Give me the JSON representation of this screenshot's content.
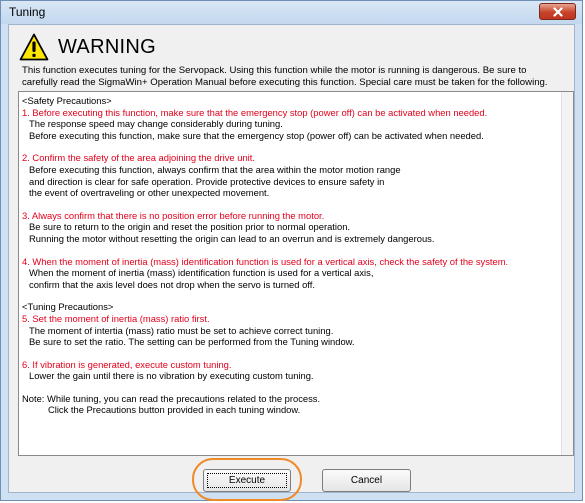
{
  "window": {
    "title": "Tuning",
    "close_icon": "close-icon",
    "accent_close": "#c7432b",
    "titlebar_color": "#cfe0f3"
  },
  "warning": {
    "icon": "warning-icon",
    "heading": "WARNING",
    "intro_line1": "This function executes tuning for the Servopack. Using this function while the motor is running is dangerous. Be sure to",
    "intro_line2": "carefully read the SigmaWin+ Operation Manual before executing this function. Special care must be taken for the following."
  },
  "precautions": {
    "safety_header": "<Safety Precautions>",
    "items": [
      {
        "title": "1. Before executing this function, make sure that the emergency stop (power off) can be activated when needed.",
        "lines": [
          "The response speed may change considerably during tuning.",
          "Before executing this function, make sure that the emergency stop (power off) can be activated when needed."
        ]
      },
      {
        "title": "2. Confirm the safety of the area adjoining the drive unit.",
        "lines": [
          "Before executing this function, always confirm that the area within the motor motion range",
          "and direction is clear for safe operation. Provide protective devices to ensure safety in",
          "the event of overtraveling or other unexpected movement."
        ]
      },
      {
        "title": "3. Always confirm that there is no position error before running the motor.",
        "lines": [
          "Be sure to return to the origin and reset the position prior to normal operation.",
          "Running the motor without resetting the origin can lead to an overrun and is extremely dangerous."
        ]
      },
      {
        "title": "4. When the moment of inertia (mass) identification function is used for a vertical axis, check the safety of the system.",
        "lines": [
          "When the moment of inertia (mass) identification function is used for a vertical axis,",
          "confirm that the axis level does not drop when the servo is turned off."
        ]
      }
    ],
    "tuning_header": "<Tuning Precautions>",
    "tuning_items": [
      {
        "title": "5. Set the moment of inertia (mass) ratio first.",
        "lines": [
          "The moment of intertia (mass) ratio must be set to achieve correct tuning.",
          "Be sure to set the ratio. The setting can be performed from the Tuning window."
        ]
      },
      {
        "title": "6. If vibration is generated, execute custom tuning.",
        "lines": [
          "Lower the gain until there is no vibration by executing custom tuning."
        ]
      }
    ],
    "note_line1": "Note: While tuning, you can read the precautions related to the process.",
    "note_line2": "Click the Precautions button provided in each tuning window."
  },
  "buttons": {
    "execute": "Execute",
    "cancel": "Cancel",
    "highlight_color": "#ef8a28",
    "warning_text_color": "#e3001b"
  }
}
